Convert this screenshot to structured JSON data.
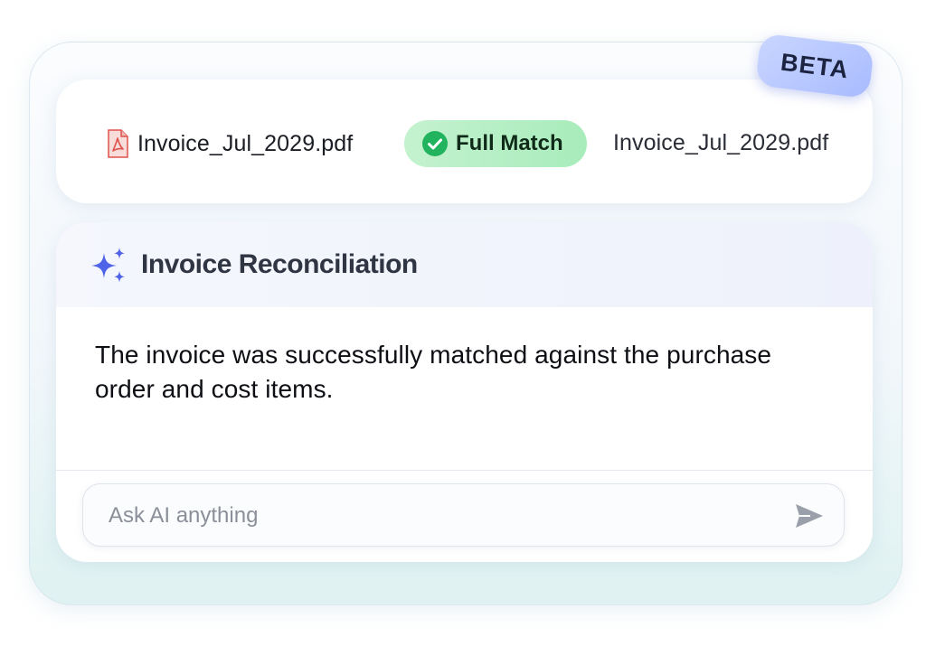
{
  "badge": {
    "label": "BETA"
  },
  "comparison": {
    "source_file": {
      "name": "Invoice_Jul_2029.pdf",
      "icon": "pdf-file-icon"
    },
    "status": {
      "label": "Full Match",
      "icon": "check-circle-icon",
      "color": "#22b35e"
    },
    "target_file": {
      "name": "Invoice_Jul_2029.pdf"
    }
  },
  "assistant": {
    "icon": "sparkle-icon",
    "title": "Invoice Reconciliation",
    "message": "The invoice was successfully matched against the purchase order and cost items.",
    "input": {
      "placeholder": "Ask AI anything",
      "value": ""
    },
    "send_icon": "send-icon"
  },
  "colors": {
    "accent": "#4f63e8",
    "match_green": "#22b35e",
    "pdf_red": "#e0524c",
    "beta_bg": "#b7c6ff"
  }
}
